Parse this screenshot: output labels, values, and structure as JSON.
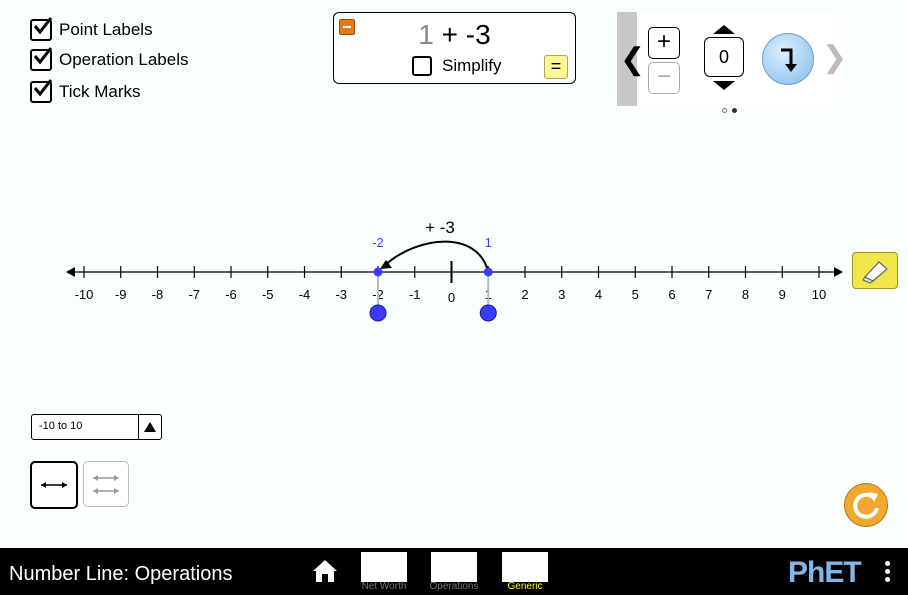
{
  "checkboxes": [
    {
      "label": "Point Labels",
      "checked": true
    },
    {
      "label": "Operation Labels",
      "checked": true
    },
    {
      "label": "Tick Marks",
      "checked": true
    }
  ],
  "equation": {
    "initial": "1",
    "operation": "+ -3",
    "simplify_label": "Simplify",
    "simplify_checked": false,
    "equals_label": "="
  },
  "carousel": {
    "plus_label": "+",
    "minus_label": "−",
    "value": "0",
    "page_dots": 2,
    "active_dot": 1
  },
  "number_line": {
    "min": -10,
    "max": 10,
    "ticks": [
      "-10",
      "-9",
      "-8",
      "-7",
      "-6",
      "-5",
      "-4",
      "-3",
      "-2",
      "-1",
      "0",
      "1",
      "2",
      "3",
      "4",
      "5",
      "6",
      "7",
      "8",
      "9",
      "10"
    ],
    "operation_label": "+ -3",
    "start_point": {
      "value": 1,
      "label": "1"
    },
    "end_point": {
      "value": -2,
      "label": "-2"
    }
  },
  "range_select": {
    "value": "-10 to 10"
  },
  "footer": {
    "title": "Number Line: Operations",
    "screens": [
      {
        "label": "Net Worth",
        "current": false
      },
      {
        "label": "Operations",
        "current": false
      },
      {
        "label": "Generic",
        "current": true
      }
    ],
    "brand": "PhET"
  },
  "colors": {
    "point": "#3b3bff",
    "background": "#f8fffe",
    "footer": "#000000",
    "eraser": "#f1e64c",
    "reset": "#f0a830"
  }
}
